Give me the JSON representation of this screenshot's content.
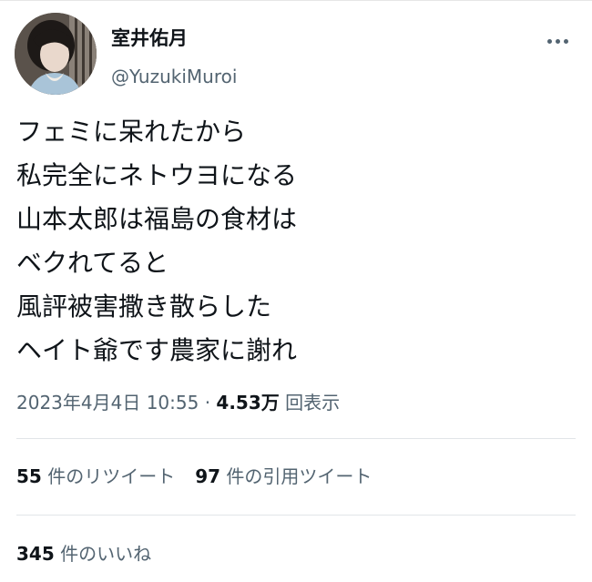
{
  "author": {
    "display_name": "室井佑月",
    "handle": "@YuzukiMuroi"
  },
  "tweet": {
    "lines": [
      "フェミに呆れたから",
      "私完全にネトウヨになる",
      "山本太郎は福島の食材は",
      "ベクれてると",
      "風評被害撒き散らした",
      "ヘイト爺です農家に謝れ"
    ],
    "timestamp": "2023年4月4日 10:55",
    "separator": "·",
    "views_count": "4.53万",
    "views_label": "回表示"
  },
  "stats": {
    "retweets_count": "55",
    "retweets_label": "件のリツイート",
    "quotes_count": "97",
    "quotes_label": "件の引用ツイート",
    "likes_count": "345",
    "likes_label": "件のいいね"
  },
  "icons": {
    "more": "more-horizontal-icon",
    "avatar": "profile-photo"
  },
  "colors": {
    "text_primary": "#0f1419",
    "text_secondary": "#536471",
    "divider": "#e1e5e8"
  }
}
